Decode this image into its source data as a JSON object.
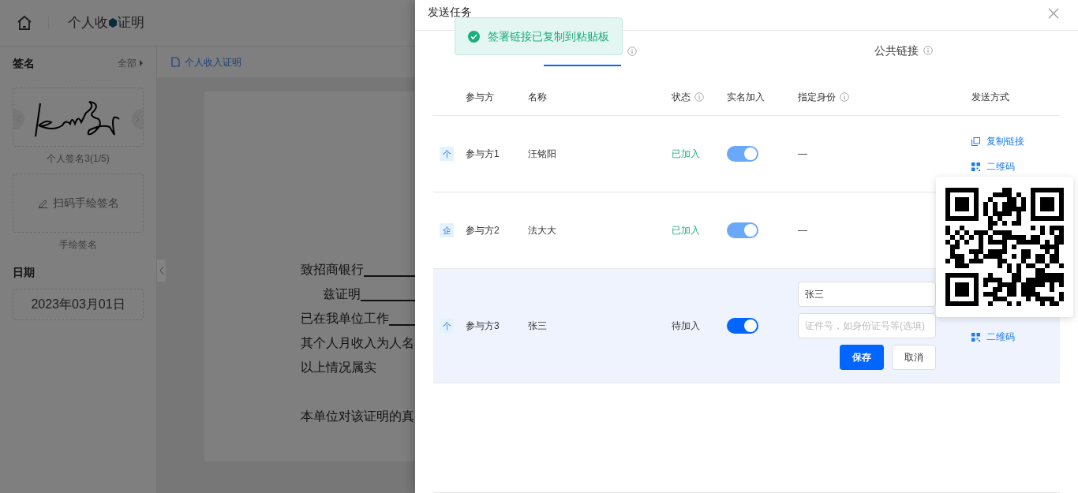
{
  "header": {
    "title_segments": [
      "个人收",
      "证明"
    ]
  },
  "sidebar": {
    "signature_title": "签名",
    "all_link": "全部",
    "signature_caption": "个人签名3(1/5)",
    "handdraw_button": "扫码手绘签名",
    "handdraw_caption": "手绘签名",
    "date_title": "日期",
    "date_value": "2023年03月01日"
  },
  "document": {
    "tab": "个人收入证明",
    "lines": [
      {
        "text": "致招商银行",
        "blank": true,
        "indent": false
      },
      {
        "text": "兹证明",
        "blank": true,
        "indent": true
      },
      {
        "text": "已在我单位工作",
        "blank": true,
        "indent": false
      },
      {
        "text": "其个人月收入为人名",
        "indent": false
      },
      {
        "text": "以上情况属实",
        "blank": false,
        "indent": false
      },
      {
        "text": "本单位对该证明的真",
        "indent": false
      }
    ]
  },
  "drawer": {
    "title": "发送任务",
    "toast": "签署链接已复制到粘贴板",
    "tabs": [
      {
        "selected": true,
        "info": true
      },
      {
        "label": "公共链接",
        "selected": false,
        "info": true
      }
    ],
    "columns": [
      {
        "label": "参与方"
      },
      {
        "label": "名称"
      },
      {
        "label": "状态",
        "info": true
      },
      {
        "label": "实名加入"
      },
      {
        "label": "指定身份",
        "info": true
      },
      {
        "label": "发送方式"
      }
    ],
    "rows": [
      {
        "badge": "个",
        "party": "参与方1",
        "name": "汪铭阳",
        "status": "已加入",
        "joined": true,
        "on": true,
        "disabled": true,
        "selected": false,
        "identity": {
          "kind": "dash",
          "text": "—"
        },
        "send": [
          {
            "kind": "copy",
            "label": "复制链接"
          },
          {
            "kind": "qr",
            "label": "二维码"
          }
        ]
      },
      {
        "badge": "企",
        "party": "参与方2",
        "name": "法大大",
        "status": "已加入",
        "joined": true,
        "on": true,
        "disabled": true,
        "selected": false,
        "identity": {
          "kind": "dash",
          "text": "—"
        },
        "send": []
      },
      {
        "badge": "个",
        "party": "参与方3",
        "name": "张三",
        "status": "待加入",
        "joined": false,
        "on": true,
        "disabled": false,
        "selected": true,
        "identity": {
          "kind": "edit",
          "value": "张三",
          "placeholder": "证件号，如身份证号等(选填)",
          "save": "保存",
          "cancel": "取消"
        },
        "send": [
          {
            "kind": "qr",
            "label": "二维码"
          }
        ]
      }
    ]
  }
}
